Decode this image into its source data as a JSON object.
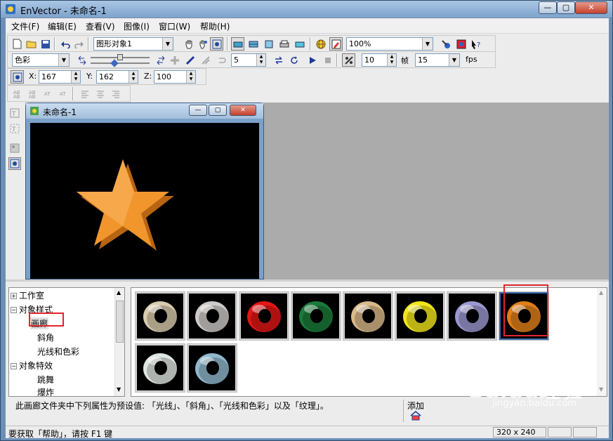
{
  "window": {
    "title": "EnVector - 未命名-1"
  },
  "menu": [
    "文件(F)",
    "编辑(E)",
    "查看(V)",
    "图像(I)",
    "窗口(W)",
    "帮助(H)"
  ],
  "toolbar1": {
    "object_combo": "图形对象1",
    "zoom_combo": "100%"
  },
  "toolbar2": {
    "color_combo": "色彩",
    "steps_value": "5",
    "frames_value": "10",
    "frame_label": "帧",
    "fps_value": "15",
    "fps_label": "fps"
  },
  "toolbar3": {
    "x_label": "X:",
    "x_value": "167",
    "y_label": "Y:",
    "y_value": "162",
    "z_label": "Z:",
    "z_value": "100"
  },
  "document": {
    "title": "未命名-1",
    "shape_color": "#f0962d"
  },
  "tree": {
    "items": [
      "工作室",
      "对象样式",
      "画廊",
      "斜角",
      "光线和色彩",
      "对象特效",
      "跳舞",
      "爆炸"
    ]
  },
  "gallery": {
    "thumbs": [
      {
        "color": "#d9ccae",
        "name": "cream"
      },
      {
        "color": "#cfcac7",
        "name": "silver"
      },
      {
        "color": "#e11717",
        "name": "red"
      },
      {
        "color": "#1b7a3a",
        "name": "green"
      },
      {
        "color": "#d9b98a",
        "name": "tan"
      },
      {
        "color": "#f2e61a",
        "name": "yellow"
      },
      {
        "color": "#9a98cf",
        "name": "lavender"
      },
      {
        "color": "#e07f1a",
        "name": "orange"
      },
      {
        "color": "#dfe6e2",
        "name": "white"
      },
      {
        "color": "#8fb8cc",
        "name": "light-blue"
      }
    ],
    "selected_index": 7
  },
  "description": {
    "text": "此画廊文件夹中下列属性为预设值: 「光线」、「斜角」、「光线和色彩」以及「纹理」。",
    "add_label": "添加"
  },
  "status": {
    "help_text": "要获取「帮助」，请按 F1 键",
    "size": "320 x 240"
  },
  "watermark": {
    "brand": "Baidu经验",
    "url": "jingyan.baidu.com"
  },
  "colors": {
    "selection_highlight": "#e0262d",
    "mdi_background": "#ababab"
  }
}
